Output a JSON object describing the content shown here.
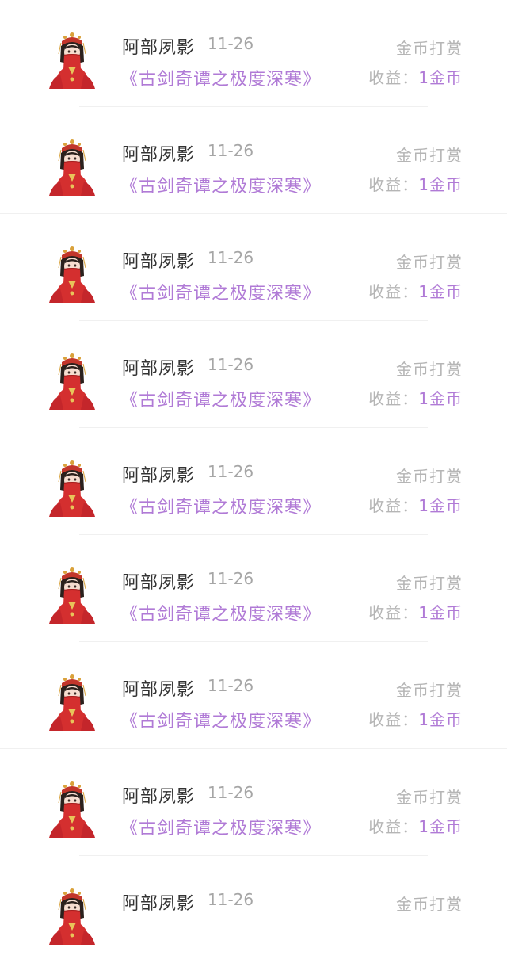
{
  "colors": {
    "accent": "#b07ad6",
    "name_text": "#333333",
    "muted_text": "#a6a6a6",
    "divider": "#f0f0f0"
  },
  "records": [
    {
      "name": "阿部夙影",
      "date": "11-26",
      "book": "《古剑奇谭之极度深寒》",
      "tip_type": "金币打赏",
      "income_label": "收益：",
      "income_value": "1金币",
      "avatar_icon": "bride-avatar-icon"
    },
    {
      "name": "阿部夙影",
      "date": "11-26",
      "book": "《古剑奇谭之极度深寒》",
      "tip_type": "金币打赏",
      "income_label": "收益：",
      "income_value": "1金币",
      "avatar_icon": "bride-avatar-icon"
    },
    {
      "name": "阿部夙影",
      "date": "11-26",
      "book": "《古剑奇谭之极度深寒》",
      "tip_type": "金币打赏",
      "income_label": "收益：",
      "income_value": "1金币",
      "avatar_icon": "bride-avatar-icon"
    },
    {
      "name": "阿部夙影",
      "date": "11-26",
      "book": "《古剑奇谭之极度深寒》",
      "tip_type": "金币打赏",
      "income_label": "收益：",
      "income_value": "1金币",
      "avatar_icon": "bride-avatar-icon"
    },
    {
      "name": "阿部夙影",
      "date": "11-26",
      "book": "《古剑奇谭之极度深寒》",
      "tip_type": "金币打赏",
      "income_label": "收益：",
      "income_value": "1金币",
      "avatar_icon": "bride-avatar-icon"
    },
    {
      "name": "阿部夙影",
      "date": "11-26",
      "book": "《古剑奇谭之极度深寒》",
      "tip_type": "金币打赏",
      "income_label": "收益：",
      "income_value": "1金币",
      "avatar_icon": "bride-avatar-icon"
    },
    {
      "name": "阿部夙影",
      "date": "11-26",
      "book": "《古剑奇谭之极度深寒》",
      "tip_type": "金币打赏",
      "income_label": "收益：",
      "income_value": "1金币",
      "avatar_icon": "bride-avatar-icon"
    },
    {
      "name": "阿部夙影",
      "date": "11-26",
      "book": "《古剑奇谭之极度深寒》",
      "tip_type": "金币打赏",
      "income_label": "收益：",
      "income_value": "1金币",
      "avatar_icon": "bride-avatar-icon"
    },
    {
      "name": "阿部夙影",
      "date": "11-26",
      "book": "",
      "tip_type": "金币打赏",
      "income_label": "",
      "income_value": "",
      "avatar_icon": "bride-avatar-icon"
    }
  ]
}
